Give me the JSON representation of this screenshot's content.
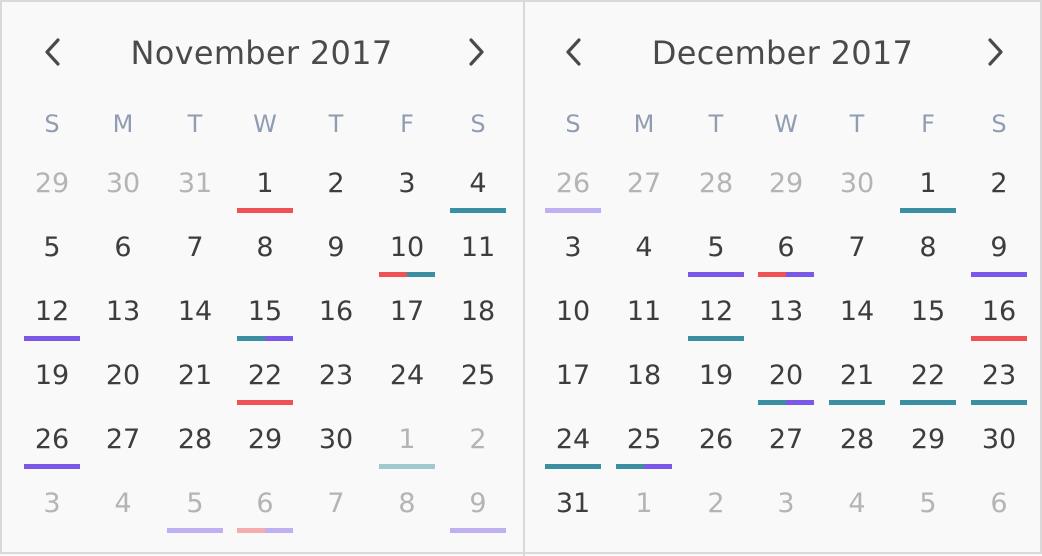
{
  "colors": {
    "red": "#f05155",
    "teal": "#3a8fa0",
    "purple": "#7b59e8",
    "text": "#3d3d3d",
    "muted_text": "#b4b4b4",
    "weekday_text": "#8f9cb1",
    "border": "#d9d9d9",
    "background": "#f9f9f9"
  },
  "weekdays": [
    "S",
    "M",
    "T",
    "W",
    "T",
    "F",
    "S"
  ],
  "navigation": {
    "prev_icon": "chevron-left-icon",
    "next_icon": "chevron-right-icon"
  },
  "months": [
    {
      "title": "November 2017",
      "weeks": [
        [
          {
            "d": "29",
            "muted": true,
            "events": []
          },
          {
            "d": "30",
            "muted": true,
            "events": []
          },
          {
            "d": "31",
            "muted": true,
            "events": []
          },
          {
            "d": "1",
            "muted": false,
            "events": [
              "red"
            ]
          },
          {
            "d": "2",
            "muted": false,
            "events": []
          },
          {
            "d": "3",
            "muted": false,
            "events": []
          },
          {
            "d": "4",
            "muted": false,
            "events": [
              "teal"
            ]
          }
        ],
        [
          {
            "d": "5",
            "muted": false,
            "events": []
          },
          {
            "d": "6",
            "muted": false,
            "events": []
          },
          {
            "d": "7",
            "muted": false,
            "events": []
          },
          {
            "d": "8",
            "muted": false,
            "events": []
          },
          {
            "d": "9",
            "muted": false,
            "events": []
          },
          {
            "d": "10",
            "muted": false,
            "events": [
              "red",
              "teal"
            ]
          },
          {
            "d": "11",
            "muted": false,
            "events": []
          }
        ],
        [
          {
            "d": "12",
            "muted": false,
            "events": [
              "purple"
            ]
          },
          {
            "d": "13",
            "muted": false,
            "events": []
          },
          {
            "d": "14",
            "muted": false,
            "events": []
          },
          {
            "d": "15",
            "muted": false,
            "events": [
              "teal",
              "purple"
            ]
          },
          {
            "d": "16",
            "muted": false,
            "events": []
          },
          {
            "d": "17",
            "muted": false,
            "events": []
          },
          {
            "d": "18",
            "muted": false,
            "events": []
          }
        ],
        [
          {
            "d": "19",
            "muted": false,
            "events": []
          },
          {
            "d": "20",
            "muted": false,
            "events": []
          },
          {
            "d": "21",
            "muted": false,
            "events": []
          },
          {
            "d": "22",
            "muted": false,
            "events": [
              "red"
            ]
          },
          {
            "d": "23",
            "muted": false,
            "events": []
          },
          {
            "d": "24",
            "muted": false,
            "events": []
          },
          {
            "d": "25",
            "muted": false,
            "events": []
          }
        ],
        [
          {
            "d": "26",
            "muted": false,
            "events": [
              "purple"
            ]
          },
          {
            "d": "27",
            "muted": false,
            "events": []
          },
          {
            "d": "28",
            "muted": false,
            "events": []
          },
          {
            "d": "29",
            "muted": false,
            "events": []
          },
          {
            "d": "30",
            "muted": false,
            "events": []
          },
          {
            "d": "1",
            "muted": true,
            "events": [
              "teal"
            ]
          },
          {
            "d": "2",
            "muted": true,
            "events": []
          }
        ],
        [
          {
            "d": "3",
            "muted": true,
            "events": []
          },
          {
            "d": "4",
            "muted": true,
            "events": []
          },
          {
            "d": "5",
            "muted": true,
            "events": [
              "purple"
            ]
          },
          {
            "d": "6",
            "muted": true,
            "events": [
              "red",
              "purple"
            ]
          },
          {
            "d": "7",
            "muted": true,
            "events": []
          },
          {
            "d": "8",
            "muted": true,
            "events": []
          },
          {
            "d": "9",
            "muted": true,
            "events": [
              "purple"
            ]
          }
        ]
      ]
    },
    {
      "title": "December 2017",
      "weeks": [
        [
          {
            "d": "26",
            "muted": true,
            "events": [
              "purple"
            ]
          },
          {
            "d": "27",
            "muted": true,
            "events": []
          },
          {
            "d": "28",
            "muted": true,
            "events": []
          },
          {
            "d": "29",
            "muted": true,
            "events": []
          },
          {
            "d": "30",
            "muted": true,
            "events": []
          },
          {
            "d": "1",
            "muted": false,
            "events": [
              "teal"
            ]
          },
          {
            "d": "2",
            "muted": false,
            "events": []
          }
        ],
        [
          {
            "d": "3",
            "muted": false,
            "events": []
          },
          {
            "d": "4",
            "muted": false,
            "events": []
          },
          {
            "d": "5",
            "muted": false,
            "events": [
              "purple"
            ]
          },
          {
            "d": "6",
            "muted": false,
            "events": [
              "red",
              "purple"
            ]
          },
          {
            "d": "7",
            "muted": false,
            "events": []
          },
          {
            "d": "8",
            "muted": false,
            "events": []
          },
          {
            "d": "9",
            "muted": false,
            "events": [
              "purple"
            ]
          }
        ],
        [
          {
            "d": "10",
            "muted": false,
            "events": []
          },
          {
            "d": "11",
            "muted": false,
            "events": []
          },
          {
            "d": "12",
            "muted": false,
            "events": [
              "teal"
            ]
          },
          {
            "d": "13",
            "muted": false,
            "events": []
          },
          {
            "d": "14",
            "muted": false,
            "events": []
          },
          {
            "d": "15",
            "muted": false,
            "events": []
          },
          {
            "d": "16",
            "muted": false,
            "events": [
              "red"
            ]
          }
        ],
        [
          {
            "d": "17",
            "muted": false,
            "events": []
          },
          {
            "d": "18",
            "muted": false,
            "events": []
          },
          {
            "d": "19",
            "muted": false,
            "events": []
          },
          {
            "d": "20",
            "muted": false,
            "events": [
              "teal",
              "purple"
            ]
          },
          {
            "d": "21",
            "muted": false,
            "events": [
              "teal"
            ]
          },
          {
            "d": "22",
            "muted": false,
            "events": [
              "teal"
            ]
          },
          {
            "d": "23",
            "muted": false,
            "events": [
              "teal"
            ]
          }
        ],
        [
          {
            "d": "24",
            "muted": false,
            "events": [
              "teal"
            ]
          },
          {
            "d": "25",
            "muted": false,
            "events": [
              "teal",
              "purple"
            ]
          },
          {
            "d": "26",
            "muted": false,
            "events": []
          },
          {
            "d": "27",
            "muted": false,
            "events": []
          },
          {
            "d": "28",
            "muted": false,
            "events": []
          },
          {
            "d": "29",
            "muted": false,
            "events": []
          },
          {
            "d": "30",
            "muted": false,
            "events": []
          }
        ],
        [
          {
            "d": "31",
            "muted": false,
            "events": []
          },
          {
            "d": "1",
            "muted": true,
            "events": []
          },
          {
            "d": "2",
            "muted": true,
            "events": []
          },
          {
            "d": "3",
            "muted": true,
            "events": []
          },
          {
            "d": "4",
            "muted": true,
            "events": []
          },
          {
            "d": "5",
            "muted": true,
            "events": []
          },
          {
            "d": "6",
            "muted": true,
            "events": []
          }
        ]
      ]
    }
  ]
}
